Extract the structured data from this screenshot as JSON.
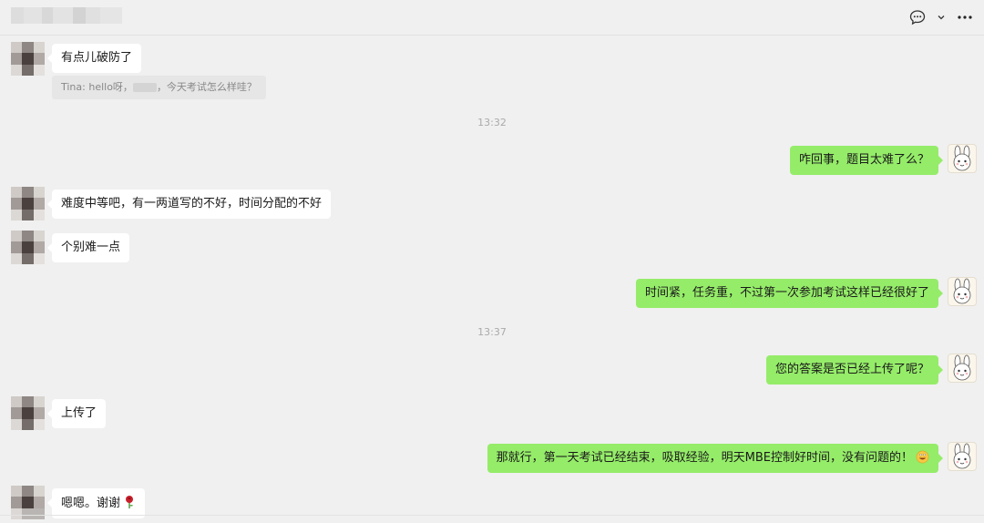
{
  "window": {
    "title_blurred": true
  },
  "header": {
    "icons": [
      "chat-bubble-icon",
      "chevron-down-icon",
      "more-icon"
    ]
  },
  "messages": [
    {
      "side": "left",
      "text": "有点儿破防了"
    },
    {
      "side": "quote",
      "prefix": "Tina: hello呀，",
      "suffix": "，今天考试怎么样哇？"
    },
    {
      "side": "time",
      "text": "13:32"
    },
    {
      "side": "right",
      "text": "咋回事，题目太难了么？"
    },
    {
      "side": "left",
      "text": "难度中等吧，有一两道写的不好，时间分配的不好"
    },
    {
      "side": "left",
      "text": "个别难一点"
    },
    {
      "side": "right",
      "text": "时间紧，任务重，不过第一次参加考试这样已经很好了"
    },
    {
      "side": "time",
      "text": "13:37"
    },
    {
      "side": "right",
      "text": "您的答案是否已经上传了呢？"
    },
    {
      "side": "left",
      "text": "上传了"
    },
    {
      "side": "right",
      "text": "那就行，第一天考试已经结束，吸取经验，明天MBE控制好时间，没有问题的！",
      "emoji": "grin-emoji-icon"
    },
    {
      "side": "left",
      "text": "嗯嗯。谢谢",
      "emoji": "rose-icon"
    }
  ],
  "colors": {
    "background": "#f0f0f0",
    "bubble_left": "#ffffff",
    "bubble_right": "#95ec69",
    "timestamp": "#aaaaaa"
  }
}
